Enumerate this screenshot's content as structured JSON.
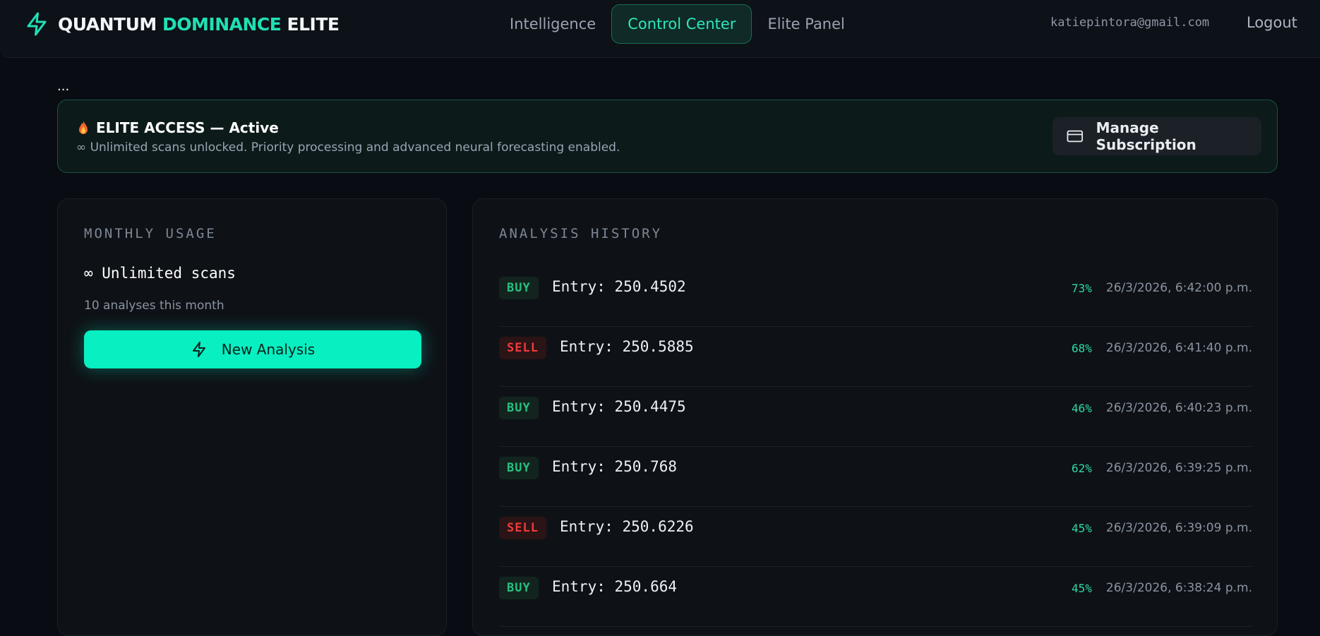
{
  "header": {
    "brand_part1": "QUANTUM",
    "brand_part2": "DOMINANCE",
    "brand_part3": "ELITE",
    "brand_icon": "lightning-icon",
    "nav": [
      {
        "label": "Intelligence",
        "active": false
      },
      {
        "label": "Control Center",
        "active": true
      },
      {
        "label": "Elite Panel",
        "active": false
      }
    ],
    "email": "katiepintora@gmail.com",
    "logout_label": "Logout"
  },
  "ellipsis": "...",
  "banner": {
    "title": "ELITE ACCESS — Active",
    "subtitle": "∞ Unlimited scans unlocked. Priority processing and advanced neural forecasting enabled.",
    "icon": "flame-icon",
    "manage_label": "Manage Subscription",
    "manage_icon": "credit-card-icon"
  },
  "usage": {
    "heading": "MONTHLY USAGE",
    "unlimited": "∞ Unlimited scans",
    "count_text": "10 analyses this month",
    "new_analysis_label": "New Analysis",
    "new_analysis_icon": "lightning-icon"
  },
  "history": {
    "heading": "ANALYSIS HISTORY",
    "rows": [
      {
        "side": "BUY",
        "entry": "Entry: 250.4502",
        "confidence": "73%",
        "time": "26/3/2026, 6:42:00 p.m."
      },
      {
        "side": "SELL",
        "entry": "Entry: 250.5885",
        "confidence": "68%",
        "time": "26/3/2026, 6:41:40 p.m."
      },
      {
        "side": "BUY",
        "entry": "Entry: 250.4475",
        "confidence": "46%",
        "time": "26/3/2026, 6:40:23 p.m."
      },
      {
        "side": "BUY",
        "entry": "Entry: 250.768",
        "confidence": "62%",
        "time": "26/3/2026, 6:39:25 p.m."
      },
      {
        "side": "SELL",
        "entry": "Entry: 250.6226",
        "confidence": "45%",
        "time": "26/3/2026, 6:39:09 p.m."
      },
      {
        "side": "BUY",
        "entry": "Entry: 250.664",
        "confidence": "45%",
        "time": "26/3/2026, 6:38:24 p.m."
      }
    ]
  },
  "colors": {
    "accent": "#08efc1",
    "buy": "#27c07d",
    "sell": "#ef3b3b",
    "background": "#090c12"
  }
}
